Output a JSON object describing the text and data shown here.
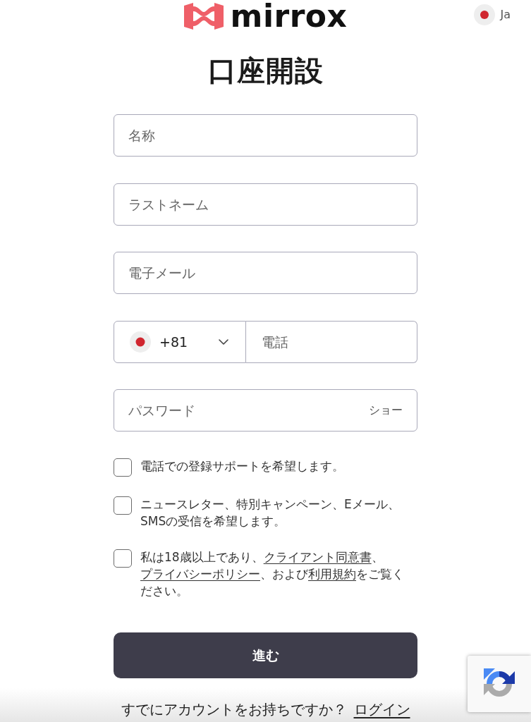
{
  "header": {
    "logo": "mirrox",
    "language": "Ja"
  },
  "title": "口座開設",
  "fields": [
    {
      "kind": "text",
      "placeholder": "名称"
    },
    {
      "kind": "text",
      "placeholder": "ラストネーム"
    },
    {
      "kind": "text",
      "placeholder": "電子メール"
    },
    {
      "kind": "phone",
      "country_code": "+81",
      "placeholder": "電話"
    },
    {
      "kind": "password",
      "placeholder": "パスワード",
      "toggle": "ショー"
    }
  ],
  "checkboxes": [
    {
      "checked": false,
      "parts": [
        {
          "kind": "text",
          "text": "電話での登録サポートを希望します。"
        }
      ]
    },
    {
      "checked": false,
      "parts": [
        {
          "kind": "text",
          "text": "ニュースレター、特別キャンペーン、Eメール、SMSの受信を希望します。"
        }
      ]
    },
    {
      "checked": false,
      "parts": [
        {
          "kind": "text",
          "text": "私は18歳以上であり、"
        },
        {
          "kind": "link",
          "text": "クライアント同意書"
        },
        {
          "kind": "text",
          "text": "、"
        },
        {
          "kind": "link",
          "text": "プライバシーポリシー"
        },
        {
          "kind": "text",
          "text": "、および"
        },
        {
          "kind": "link",
          "text": "利用規約"
        },
        {
          "kind": "text",
          "text": "をご覧ください。"
        }
      ]
    }
  ],
  "submit": "進む",
  "login_prompt": {
    "text": "すでにアカウントをお持ちですか？",
    "link": "ログイン"
  }
}
